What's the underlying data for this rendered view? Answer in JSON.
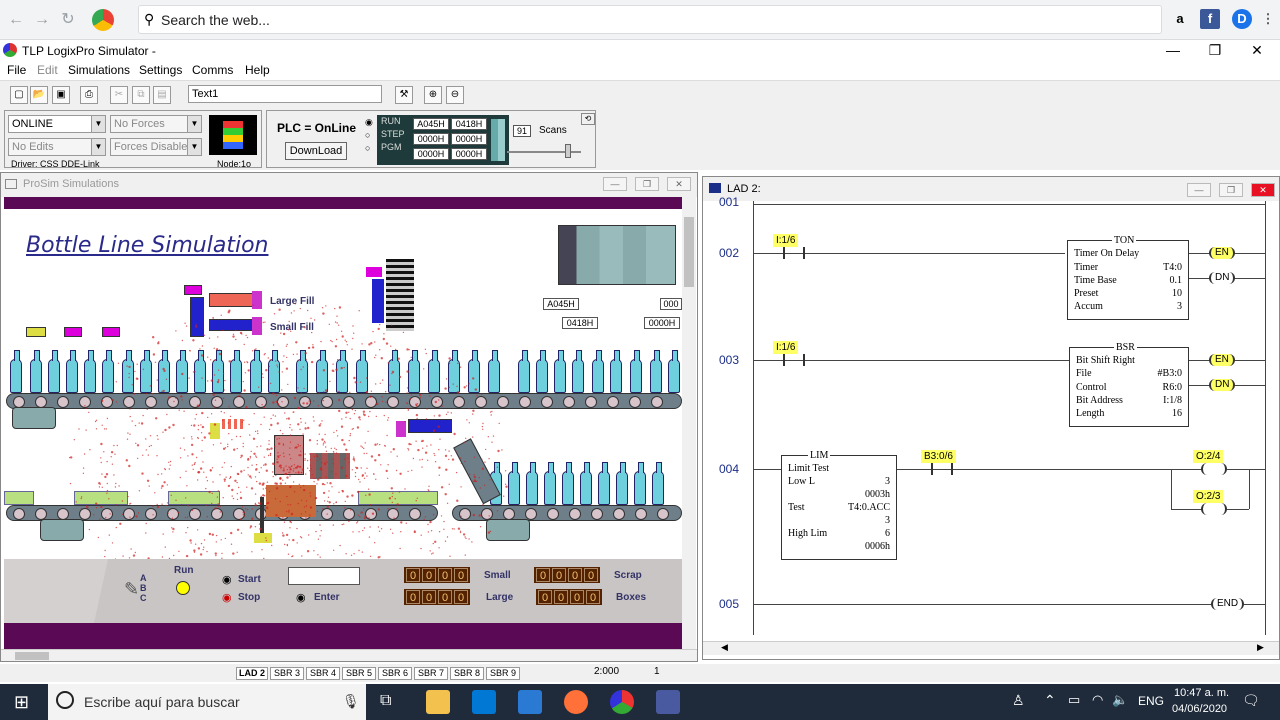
{
  "browser": {
    "search_placeholder": "Search the web..."
  },
  "app": {
    "title": "TLP LogixPro Simulator -",
    "menu": [
      "File",
      "Edit",
      "Simulations",
      "Settings",
      "Comms",
      "Help"
    ],
    "text_field": "Text1"
  },
  "plc": {
    "mode": "ONLINE",
    "forces": "No Forces",
    "edits": "No Edits",
    "forces_state": "Forces Disabled",
    "driver": "Driver: CSS DDE-Link",
    "node": "Node:1o",
    "status": "PLC = OnLine",
    "download": "DownLoad",
    "run": "RUN",
    "step": "STEP",
    "pgm": "PGM",
    "reg1": "A045H",
    "reg2": "0418H",
    "reg3": "0000H",
    "reg4": "0000H",
    "reg5": "0000H",
    "reg6": "0000H",
    "scans": "91",
    "scans_label": "Scans"
  },
  "prosim": {
    "title": "ProSim Simulations",
    "sim_title": "Bottle Line Simulation",
    "large_fill": "Large Fill",
    "small_fill": "Small Fill",
    "readout1": "A045H",
    "readout2": "0418H",
    "readout3": "000",
    "readout4": "0000H",
    "run": "Run",
    "start": "Start",
    "stop": "Stop",
    "enter": "Enter",
    "abc": "A\nB\nC",
    "small": "Small",
    "large": "Large",
    "scrap": "Scrap",
    "boxes": "Boxes",
    "small_val": "0000",
    "large_val": "0000",
    "scrap_val": "0000",
    "boxes_val": "0000"
  },
  "lad": {
    "title": "LAD 2:",
    "rungs": [
      "001",
      "002",
      "003",
      "004",
      "005"
    ],
    "r2": {
      "contact": "I:1/6",
      "block_title": "TON",
      "block_name": "Timer On Delay",
      "rows": [
        [
          "Timer",
          "T4:0"
        ],
        [
          "Time Base",
          "0.1"
        ],
        [
          "Preset",
          "10"
        ],
        [
          "Accum",
          "3"
        ]
      ],
      "en": "EN",
      "dn": "DN"
    },
    "r3": {
      "contact": "I:1/6",
      "block_title": "BSR",
      "block_name": "Bit Shift Right",
      "rows": [
        [
          "File",
          "#B3:0"
        ],
        [
          "Control",
          "R6:0"
        ],
        [
          "Bit Address",
          "I:1/8"
        ],
        [
          "Length",
          "16"
        ]
      ],
      "en": "EN",
      "dn": "DN"
    },
    "r4": {
      "block_title": "LIM",
      "block_name": "Limit Test",
      "low": "Low L",
      "low_v": "3",
      "low_h": "0003h",
      "test": "Test",
      "test_v": "T4:0.ACC",
      "test_n": "3",
      "high": "High Lim",
      "high_v": "6",
      "high_h": "0006h",
      "contact": "B3:0/6",
      "coil1": "O:2/4",
      "coil2": "O:2/3"
    },
    "r5": {
      "end": "END"
    }
  },
  "tabs": [
    "LAD 2",
    "SBR 3",
    "SBR 4",
    "SBR 5",
    "SBR 6",
    "SBR 7",
    "SBR 8",
    "SBR 9"
  ],
  "status": {
    "time": "2:000",
    "num": "1"
  },
  "taskbar": {
    "search": "Escribe aquí para buscar",
    "lang": "ENG",
    "time": "10:47 a. m.",
    "date": "04/06/2020"
  }
}
